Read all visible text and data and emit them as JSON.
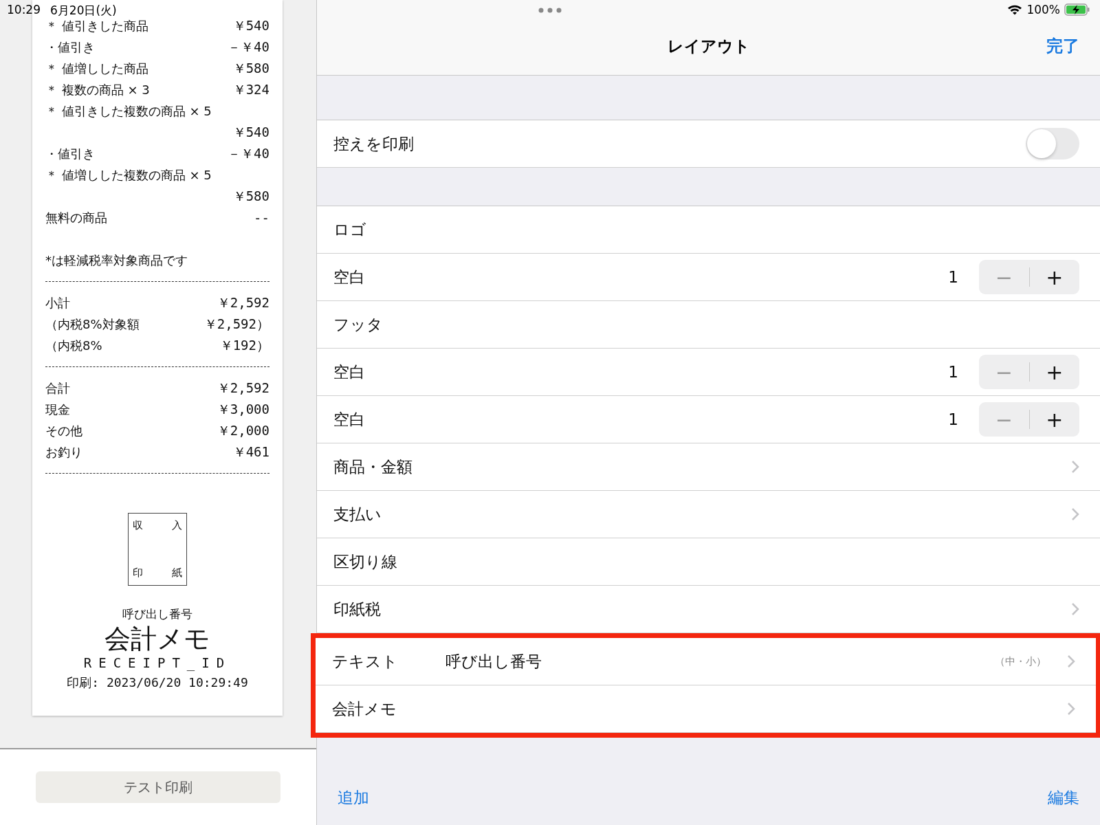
{
  "status_bar": {
    "time": "10:29",
    "date": "6月20日(火)",
    "battery": "100%"
  },
  "receipt": {
    "lines": [
      {
        "kind": "item",
        "label": "＊ 値引きした商品",
        "amount": "￥540"
      },
      {
        "kind": "item",
        "label": "・値引き",
        "amount": "－￥40"
      },
      {
        "kind": "item",
        "label": "＊ 値増しした商品",
        "amount": "￥580"
      },
      {
        "kind": "item",
        "label": "＊ 複数の商品 × 3",
        "amount": "￥324"
      },
      {
        "kind": "item",
        "label": "＊ 値引きした複数の商品 × 5"
      },
      {
        "kind": "item",
        "amount": "￥540"
      },
      {
        "kind": "item",
        "label": "・値引き",
        "amount": "－￥40"
      },
      {
        "kind": "item",
        "label": "＊ 値増しした複数の商品 × 5"
      },
      {
        "kind": "item",
        "amount": "￥580"
      },
      {
        "kind": "item",
        "label": "無料の商品",
        "amount": "--"
      },
      {
        "kind": "blank"
      },
      {
        "kind": "item",
        "label": "*は軽減税率対象商品です"
      },
      {
        "kind": "divider"
      },
      {
        "kind": "item",
        "label": "小計",
        "amount": "￥2,592"
      },
      {
        "kind": "item",
        "label": "（内税8%対象額",
        "amount": "￥2,592）"
      },
      {
        "kind": "item",
        "label": "（内税8%",
        "amount": "￥192）"
      },
      {
        "kind": "divider"
      },
      {
        "kind": "item",
        "label": "合計",
        "amount": "￥2,592"
      },
      {
        "kind": "item",
        "label": "現金",
        "amount": "￥3,000"
      },
      {
        "kind": "item",
        "label": "その他",
        "amount": "￥2,000"
      },
      {
        "kind": "item",
        "label": "お釣り",
        "amount": "￥461"
      },
      {
        "kind": "divider"
      }
    ],
    "stamp": [
      "収",
      "入",
      "印",
      "紙"
    ],
    "call_label": "呼び出し番号",
    "memo": "会計メモ",
    "receipt_id": "RECEIPT_ID",
    "printed": "印刷: 2023/06/20 10:29:49"
  },
  "test_print_button": "テスト印刷",
  "nav": {
    "title": "レイアウト",
    "done": "完了"
  },
  "print_copy": {
    "label": "控えを印刷",
    "on": false
  },
  "rows": [
    {
      "kind": "plain",
      "label": "ロゴ"
    },
    {
      "kind": "stepper",
      "label": "空白",
      "value": "1",
      "minus": "−",
      "plus": "+"
    },
    {
      "kind": "plain",
      "label": "フッタ"
    },
    {
      "kind": "stepper",
      "label": "空白",
      "value": "1",
      "minus": "−",
      "plus": "+"
    },
    {
      "kind": "stepper",
      "label": "空白",
      "value": "1",
      "minus": "−",
      "plus": "+"
    },
    {
      "kind": "link",
      "label": "商品・金額"
    },
    {
      "kind": "link",
      "label": "支払い"
    },
    {
      "kind": "plain",
      "label": "区切り線"
    },
    {
      "kind": "link",
      "label": "印紙税"
    }
  ],
  "highlighted_rows": [
    {
      "kind": "link",
      "label": "テキスト",
      "detail": "呼び出し番号",
      "note": "（中・小）"
    },
    {
      "kind": "link",
      "label": "会計メモ"
    }
  ],
  "toolbar": {
    "add": "追加",
    "edit": "編集"
  }
}
